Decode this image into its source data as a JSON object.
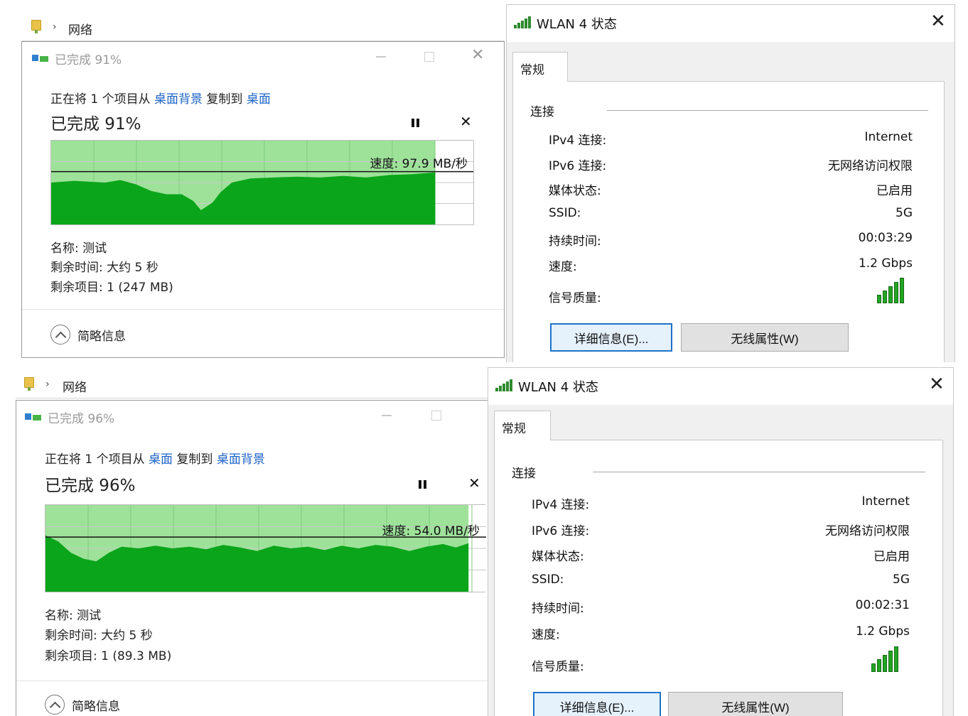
{
  "top": {
    "explorer": {
      "breadcrumb": "网络"
    },
    "copy": {
      "title": "已完成 91%",
      "line_prefix": "正在将 1 个项目从 ",
      "source": "桌面背景",
      "middle": " 复制到 ",
      "dest": "桌面",
      "percent": "已完成 91%",
      "progress_fraction": 0.91,
      "speed": "速度: 97.9 MB/秒",
      "name": "名称: 测试",
      "time_left": "剩余时间: 大约 5 秒",
      "items_left": "剩余项目: 1 (247 MB)",
      "less_details": "简略信息"
    },
    "wlan": {
      "title": "WLAN 4 状态",
      "tab_general": "常规",
      "section": "连接",
      "rows": [
        {
          "label": "IPv4 连接:",
          "value": "Internet"
        },
        {
          "label": "IPv6 连接:",
          "value": "无网络访问权限"
        },
        {
          "label": "媒体状态:",
          "value": "已启用"
        },
        {
          "label": "SSID:",
          "value": "5G"
        },
        {
          "label": "持续时间:",
          "value": "00:03:29"
        },
        {
          "label": "速度:",
          "value": "1.2 Gbps"
        }
      ],
      "signal_label": "信号质量:",
      "signal_level": 5,
      "details_button": "详细信息(E)...",
      "wireless_button": "无线属性(W)"
    }
  },
  "bottom": {
    "explorer": {
      "breadcrumb": "网络"
    },
    "copy": {
      "title": "已完成 96%",
      "line_prefix": "正在将 1 个项目从 ",
      "source": "桌面",
      "middle": " 复制到 ",
      "dest": "桌面背景",
      "percent": "已完成 96%",
      "progress_fraction": 0.96,
      "speed": "速度: 54.0 MB/秒",
      "name": "名称: 测试",
      "time_left": "剩余时间: 大约 5 秒",
      "items_left": "剩余项目: 1 (89.3 MB)",
      "less_details": "简略信息"
    },
    "wlan": {
      "title": "WLAN 4 状态",
      "tab_general": "常规",
      "section": "连接",
      "rows": [
        {
          "label": "IPv4 连接:",
          "value": "Internet"
        },
        {
          "label": "IPv6 连接:",
          "value": "无网络访问权限"
        },
        {
          "label": "媒体状态:",
          "value": "已启用"
        },
        {
          "label": "SSID:",
          "value": "5G"
        },
        {
          "label": "持续时间:",
          "value": "00:02:31"
        },
        {
          "label": "速度:",
          "value": "1.2 Gbps"
        }
      ],
      "signal_label": "信号质量:",
      "signal_level": 5,
      "details_button": "详细信息(E)...",
      "wireless_button": "无线属性(W)"
    }
  },
  "colors": {
    "graph_fill": "#0aa51a",
    "graph_band": "#9ee29a",
    "link": "#1d63c8",
    "focus_border": "#1e73c8"
  }
}
